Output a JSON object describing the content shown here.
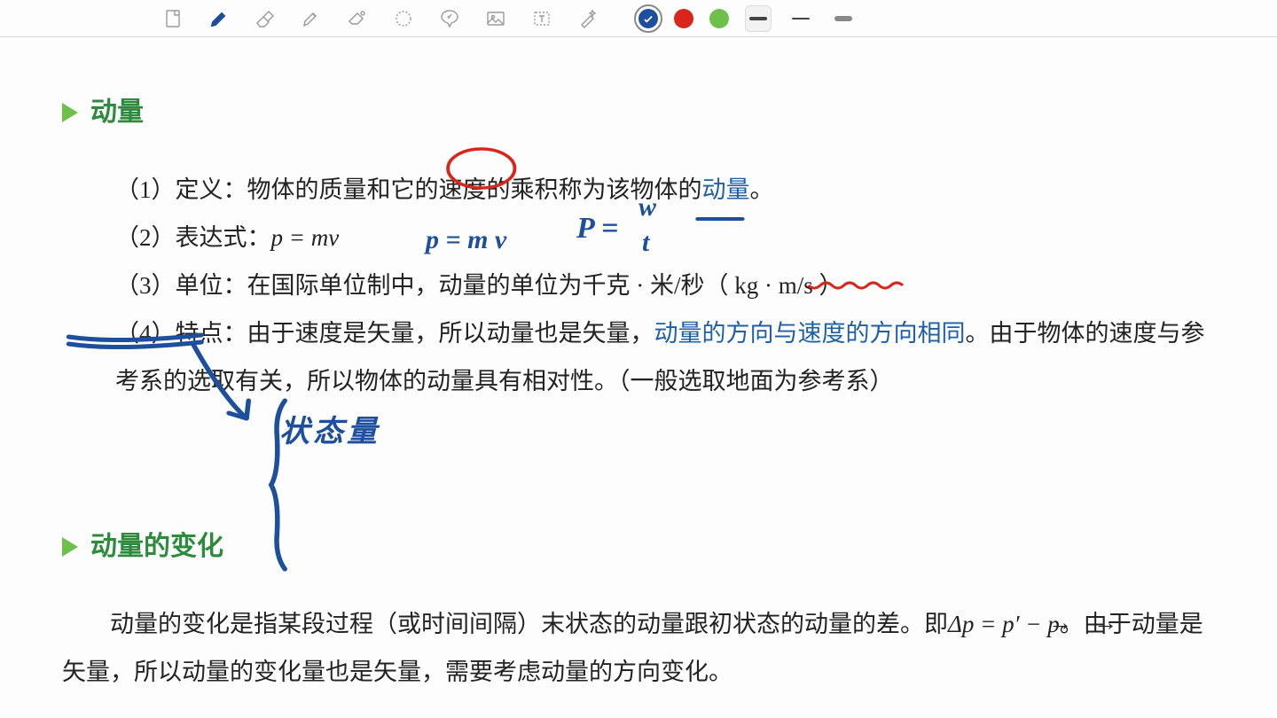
{
  "toolbar": {
    "colors": {
      "blue": "#1d4f9c",
      "red": "#d9261c",
      "green": "#6fbf4b"
    },
    "selected_color": "blue",
    "selected_stroke": "thick"
  },
  "section1": {
    "title": "动量",
    "line1_a": "（1）定义：物体的质量和它的",
    "line1_b": "速度",
    "line1_c": "的乘积称为该物体的",
    "line1_d": "动量",
    "line1_e": "。",
    "line2_a": "（2）表达式：",
    "line2_formula": "p = mv",
    "line3": "（3）单位：在国际单位制中，动量的单位为千克 · 米/秒（ kg · m/s ）",
    "line4_a": "（4）特点：由于速度是矢量，所以动量也是矢量，",
    "line4_b": "动量的方向与速度的方向相同",
    "line4_c": "。由于物体的速度与参考系的选取有关，所以物体的动量具有相对性。（一般选取地面为参考系）"
  },
  "section2": {
    "title": "动量的变化",
    "body_a": "动量的变化是指某段过程（或时间间隔）末状态的动量跟初状态的动量的差。即",
    "body_formula": "Δp = p⃗′ − p⃗",
    "body_c": "。由于动量是矢量，所以动量的变化量也是矢量，需要考虑动量的方向变化。"
  },
  "annotations": {
    "pmv": "p = m v",
    "pwt_P": "P =",
    "pwt_w": "w",
    "pwt_t": "t",
    "state": "状态量"
  }
}
